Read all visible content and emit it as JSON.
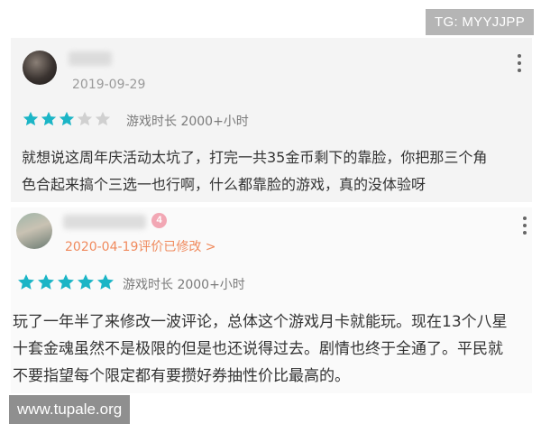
{
  "watermarks": {
    "top": "TG: MYYJJPP",
    "bottom": "www.tupale.org"
  },
  "colors": {
    "star_filled": "#1bb5c6",
    "star_empty": "#d0d0d0",
    "edited_date": "#f08a5d"
  },
  "reviews": [
    {
      "date": "2019-09-29",
      "rating": 3,
      "playtime": "游戏时长 2000+小时",
      "menu_icon": "more-vertical-icon",
      "text_lines": [
        "就想说这周年庆活动太坑了，打完一共35金币剩下的靠脸，你把那三个角",
        "色合起来搞个三选一也行啊，什么都靠脸的游戏，真的没体验呀"
      ]
    },
    {
      "badge": "4",
      "date": "2020-04-19评价已修改 >",
      "rating": 5,
      "playtime": "游戏时长 2000+小时",
      "menu_icon": "more-vertical-icon",
      "text_lines": [
        "玩了一年半了来修改一波评论，总体这个游戏月卡就能玩。现在13个八星",
        "十套金魂虽然不是极限的但是也还说得过去。剧情也终于全通了。平民就",
        "不要指望每个限定都有要攒好券抽性价比最高的。"
      ]
    }
  ]
}
